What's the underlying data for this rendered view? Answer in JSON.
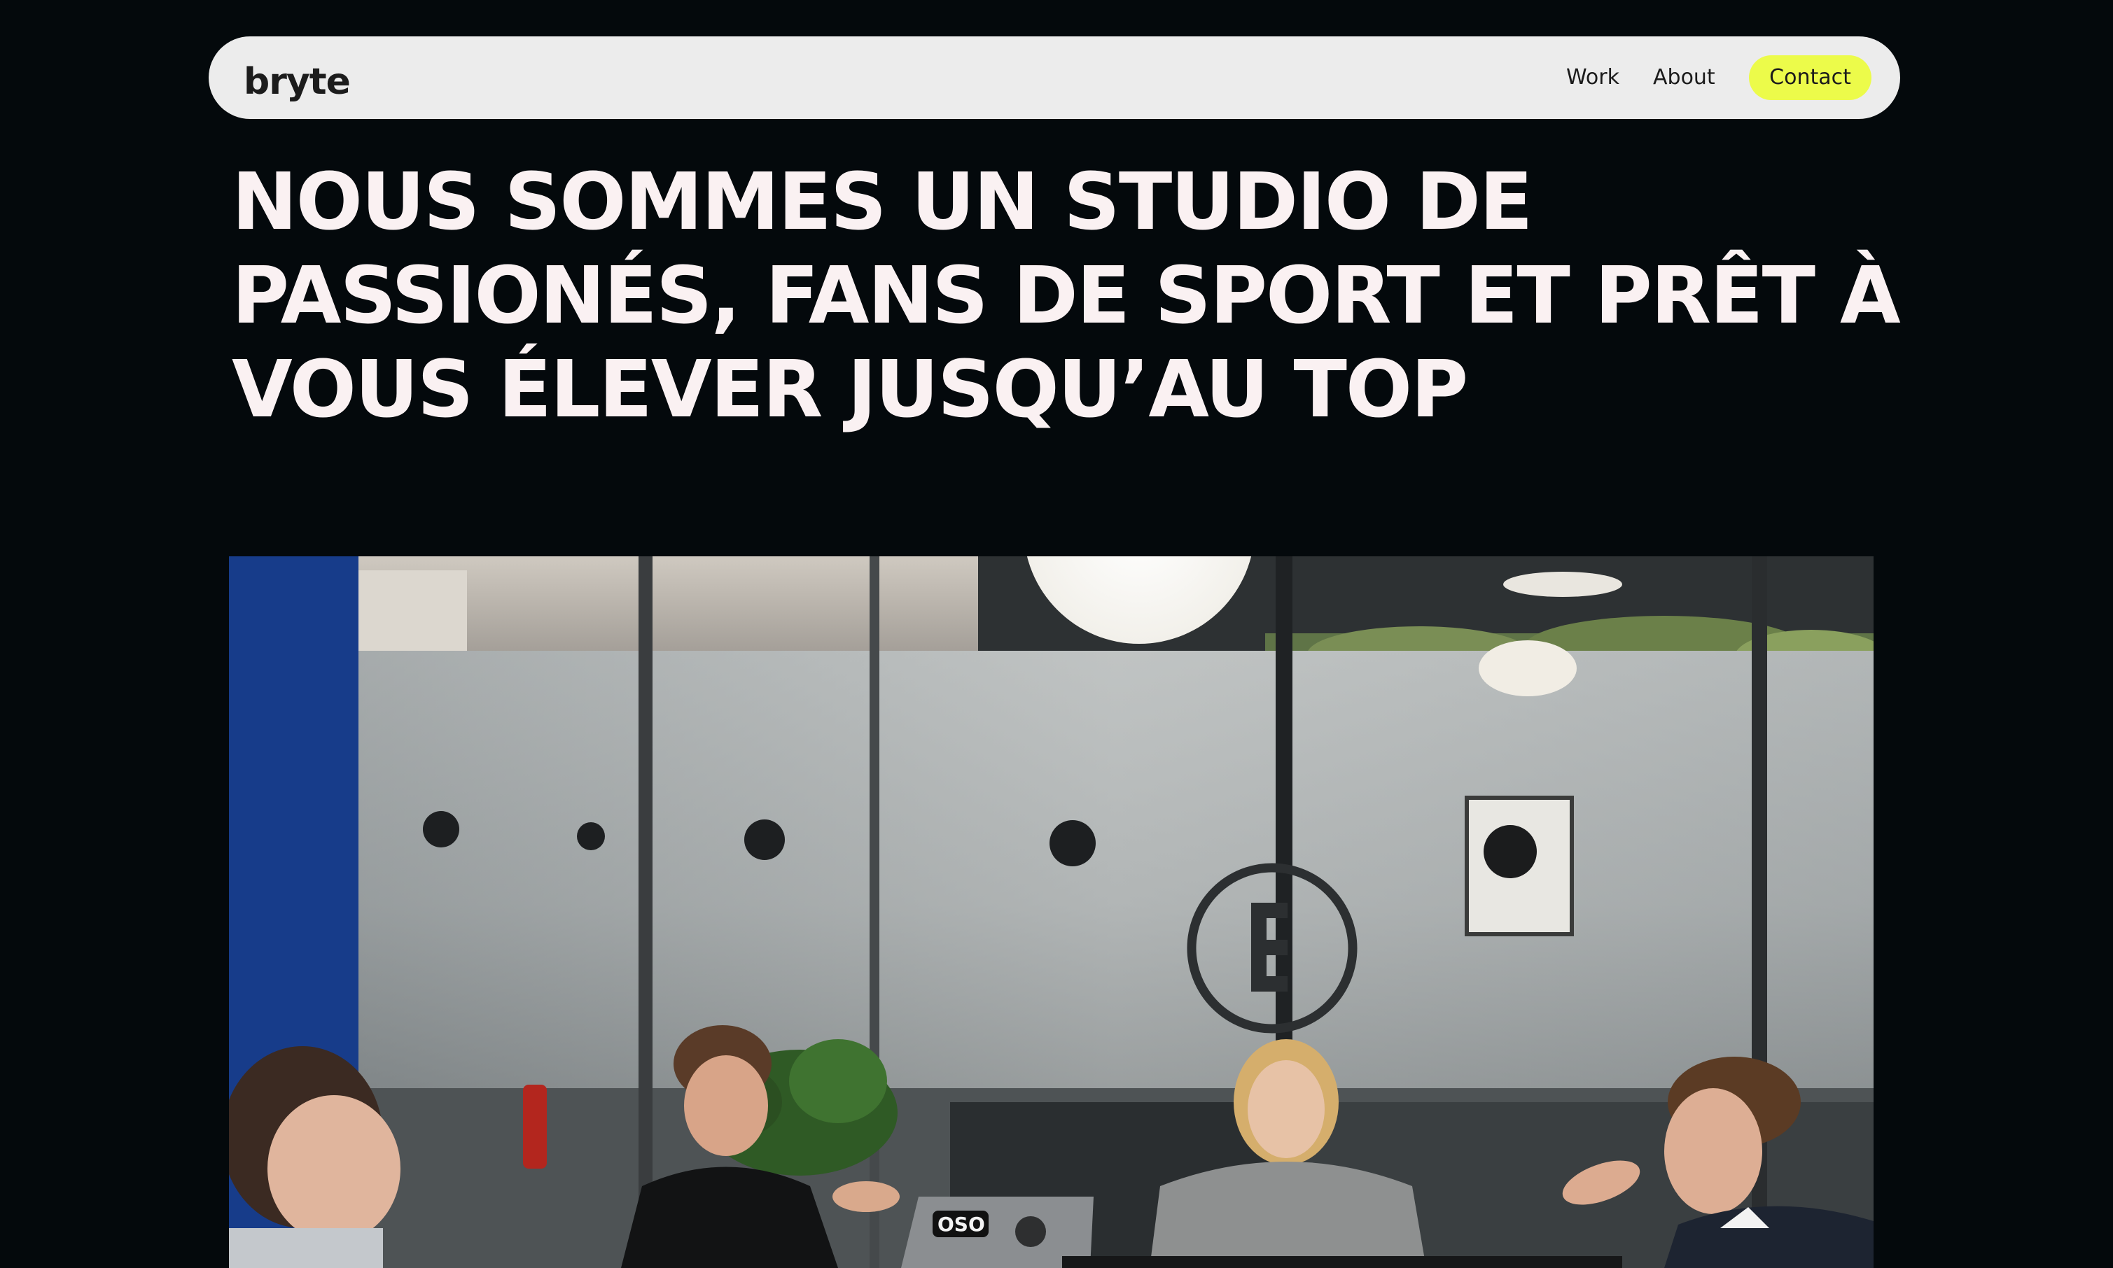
{
  "brand": {
    "logo_text": "bryte",
    "logo_icon": "bryte-wordmark"
  },
  "nav": {
    "links": [
      {
        "label": "Work"
      },
      {
        "label": "About"
      }
    ],
    "contact_label": "Contact"
  },
  "hero": {
    "title_lines": [
      "NOUS SOMMES UN STUDIO DE",
      "PASSIONÉS, FANS DE SPORT ET PRÊT À",
      "VOUS ÉLEVER JUSQU’AU TOP"
    ]
  },
  "photo": {
    "icon": "team-meeting-photo",
    "laptop_sticker_text": "OSO"
  },
  "colors": {
    "background": "#04090c",
    "navbar_bg": "#ececec",
    "accent": "#ecfb4a",
    "headline": "#faf1f2",
    "nav_text": "#1b1b1b"
  }
}
